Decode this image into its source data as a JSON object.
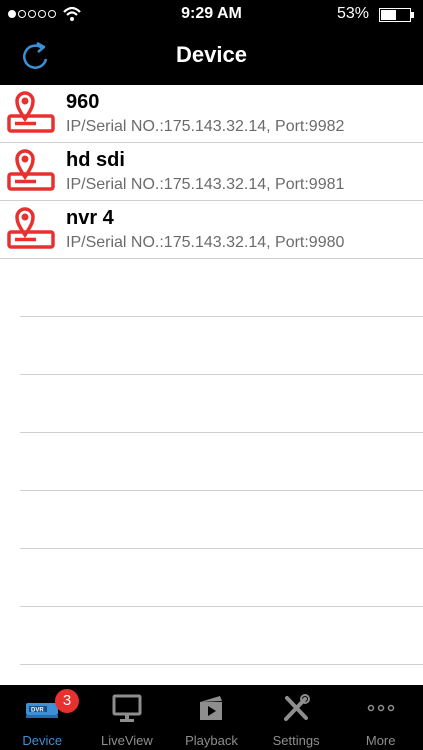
{
  "status_bar": {
    "time": "9:29 AM",
    "battery_percent": "53%",
    "battery_level": 0.53,
    "signal_bars_filled": 1,
    "signal_bars_total": 5
  },
  "nav": {
    "title": "Device",
    "refresh_icon": "refresh-icon"
  },
  "devices": [
    {
      "name": "960",
      "info": "IP/Serial NO.:175.143.32.14, Port:9982"
    },
    {
      "name": "hd sdi",
      "info": "IP/Serial NO.:175.143.32.14, Port:9981"
    },
    {
      "name": "nvr 4",
      "info": "IP/Serial NO.:175.143.32.14, Port:9980"
    }
  ],
  "tabs": [
    {
      "label": "Device",
      "icon": "dvr-icon",
      "badge": "3",
      "active": true
    },
    {
      "label": "LiveView",
      "icon": "monitor-icon"
    },
    {
      "label": "Playback",
      "icon": "playback-icon"
    },
    {
      "label": "Settings",
      "icon": "settings-icon"
    },
    {
      "label": "More",
      "icon": "more-icon"
    }
  ],
  "colors": {
    "accent": "#3d8fd6",
    "device_icon": "#e8312f",
    "badge": "#e8312f"
  }
}
